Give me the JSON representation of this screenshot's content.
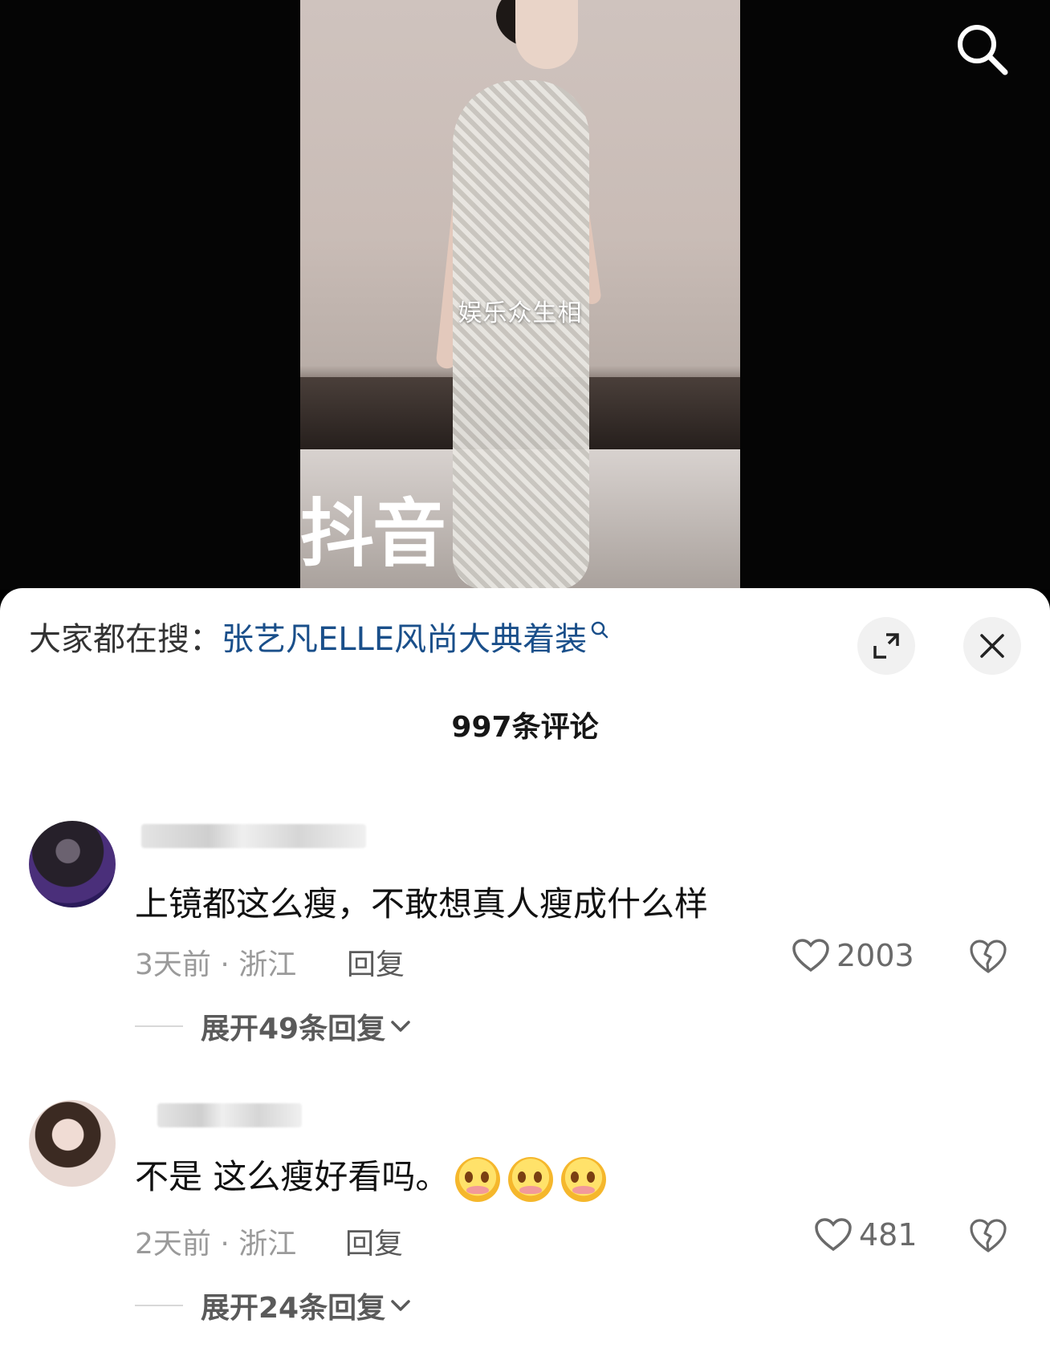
{
  "video": {
    "watermark": "娱乐众生相",
    "logo_text": "抖音"
  },
  "sheet": {
    "hot_search_label": "大家都在搜：",
    "hot_search_query": "张艺凡ELLE风尚大典着装",
    "comment_count_title": "997条评论"
  },
  "comments": [
    {
      "text": "上镜都这么瘦，不敢想真人瘦成什么样",
      "meta": "3天前 · 浙江",
      "reply_label": "回复",
      "likes": "2003",
      "expand_label": "展开49条回复"
    },
    {
      "text": "不是 这么瘦好看吗。",
      "meta": "2天前 · 浙江",
      "reply_label": "回复",
      "likes": "481",
      "expand_label": "展开24条回复",
      "emoji_count": 3
    }
  ],
  "colors": {
    "link_blue": "#1a4f8a",
    "meta_gray": "#9a9a9a",
    "text_dark": "#111111"
  }
}
